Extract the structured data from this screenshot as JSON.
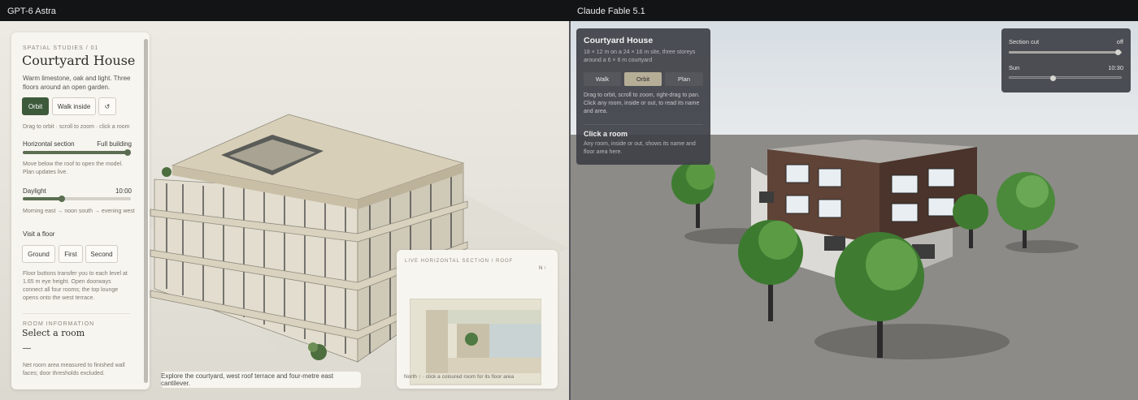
{
  "left_title": "GPT-6 Astra",
  "right_title": "Claude Fable 5.1",
  "left": {
    "kicker": "SPATIAL STUDIES / 01",
    "title": "Courtyard House",
    "subtitle": "Warm limestone, oak and light. Three floors around an open garden.",
    "buttons": {
      "orbit": "Orbit",
      "walk": "Walk inside",
      "reset": "↺"
    },
    "orbit_hint": "Drag to orbit · scroll to zoom · click a room",
    "section": {
      "label": "Horizontal section",
      "value": "Full building",
      "level": 1.0,
      "hint": "Move below the roof to open the model. Plan updates live."
    },
    "daylight": {
      "label": "Daylight",
      "value": "10:00",
      "level": 0.35,
      "hint": "Morning east → noon south → evening west"
    },
    "visit": {
      "label": "Visit a floor",
      "floors": [
        "Ground",
        "First",
        "Second"
      ],
      "hint": "Floor buttons transfer you to each level at 1.65 m eye height. Open doorways connect all four rooms; the top lounge opens onto the west terrace."
    },
    "room_info": {
      "kicker": "ROOM INFORMATION",
      "title": "Select a room",
      "dash": "—",
      "note": "Net room area measured to finished wall faces; door thresholds excluded."
    },
    "caption": "Explore the courtyard, west roof terrace and four-metre east cantilever.",
    "minimap": {
      "kicker": "LIVE HORIZONTAL SECTION / ROOF",
      "north": "N ↑",
      "footer": "North ↑ · click a coloured room for its floor area"
    }
  },
  "right": {
    "info": {
      "title": "Courtyard House",
      "desc": "18 × 12 m on a 24 × 16 m site, three storeys around a 6 × 6 m courtyard",
      "modes": [
        "Walk",
        "Orbit",
        "Plan"
      ],
      "active_mode": "Orbit",
      "help": "Drag to orbit, scroll to zoom, right-drag to pan. Click any room, inside or out, to read its name and area.",
      "click_title": "Click a room",
      "click_desc": "Any room, inside or out, shows its name and floor area here."
    },
    "controls": {
      "section_label": "Section cut",
      "section_value": "off",
      "section_level": 1.0,
      "sun_label": "Sun",
      "sun_value": "10:30",
      "sun_level": 0.38
    }
  }
}
